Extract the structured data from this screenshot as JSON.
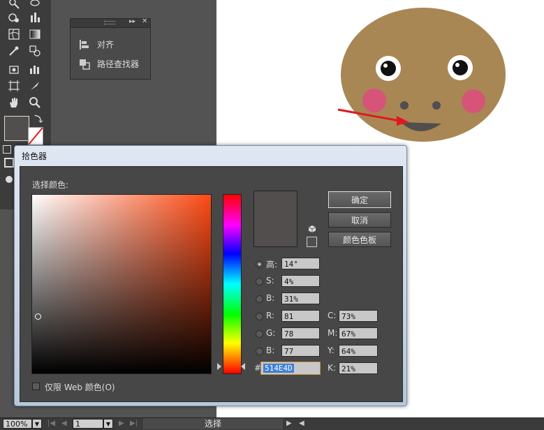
{
  "colors": {
    "face": "#A88755",
    "cheek": "#D55478",
    "mouth": "#514E4D",
    "nose": "#514E4D",
    "arrow": "#E0191F",
    "current_color": "#514E4D"
  },
  "panel": {
    "items": [
      {
        "label": "对齐",
        "icon": "align-icon"
      },
      {
        "label": "路径查找器",
        "icon": "pathfinder-icon"
      }
    ]
  },
  "dialog": {
    "title": "拾色器",
    "select_color_label": "选择颜色:",
    "buttons": {
      "ok": "确定",
      "cancel": "取消",
      "swatches": "颜色色板"
    },
    "hsb": [
      {
        "label": "高:",
        "value": "14°",
        "selected": true
      },
      {
        "label": "S:",
        "value": "4%",
        "selected": false
      },
      {
        "label": "B:",
        "value": "31%",
        "selected": false
      }
    ],
    "rgb": [
      {
        "label": "R:",
        "value": "81"
      },
      {
        "label": "G:",
        "value": "78"
      },
      {
        "label": "B:",
        "value": "77"
      }
    ],
    "cmyk": [
      {
        "label": "C:",
        "value": "73%"
      },
      {
        "label": "M:",
        "value": "67%"
      },
      {
        "label": "Y:",
        "value": "64%"
      },
      {
        "label": "K:",
        "value": "21%"
      }
    ],
    "hex_label": "#",
    "hex_value": "514E4D",
    "web_only_label": "仅限 Web 颜色(O)",
    "web_only_checked": false
  },
  "statusbar": {
    "zoom": "100%",
    "page": "1",
    "status": "选择"
  }
}
